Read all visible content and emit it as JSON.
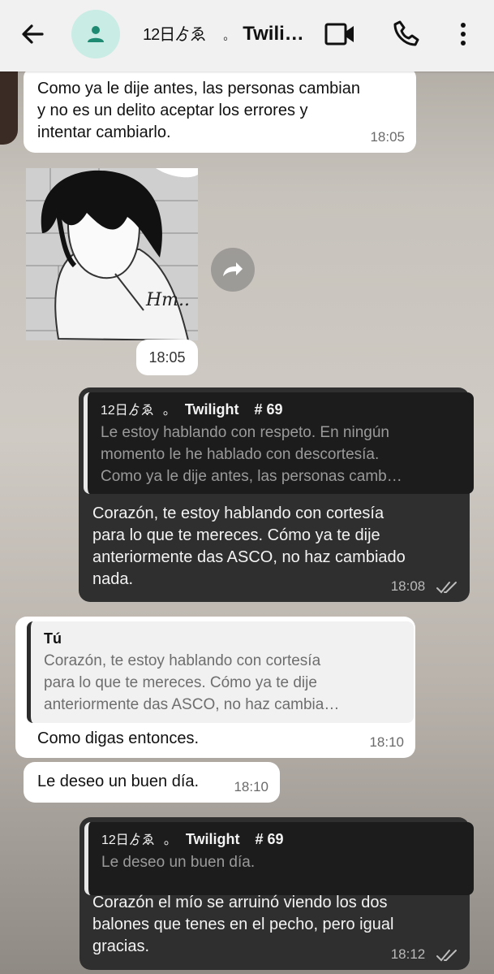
{
  "header": {
    "contact_glyph": "12日ゟゑ",
    "contact_dots": "。",
    "contact_name": "Twili…"
  },
  "messages": [
    {
      "direction": "in",
      "text": "Como ya le dije antes, las personas cambian\ny no es un delito aceptar los errores y\nintentar cambiarlo.",
      "time": "18:05"
    },
    {
      "direction": "in",
      "type": "image",
      "signature": "Hm..",
      "time": "18:05"
    },
    {
      "direction": "out",
      "quote_glyph": "12日ゟゑ",
      "quote_dots": "。",
      "quote_author": "Twilight",
      "quote_tag": "# 69",
      "quote_text": "Le estoy hablando con respeto. En ningún\nmomento le he hablado con descortesía.\nComo ya le dije antes, las personas camb…",
      "text": "Corazón, te estoy hablando con cortesía\npara lo que te mereces. Cómo ya te dije\nanteriormente das ASCO, no haz cambiado\nnada.",
      "time": "18:08"
    },
    {
      "direction": "in",
      "quote_author": "Tú",
      "quote_text": "Corazón, te estoy hablando con cortesía\npara lo que te mereces. Cómo ya te dije\nanteriormente das ASCO, no haz cambia…",
      "text": "Como digas entonces.",
      "time": "18:10"
    },
    {
      "direction": "in",
      "text": "Le deseo un buen día.",
      "time": "18:10"
    },
    {
      "direction": "out",
      "quote_glyph": "12日ゟゑ",
      "quote_dots": "。",
      "quote_author": "Twilight",
      "quote_tag": "# 69",
      "quote_text": "Le deseo un buen día.",
      "text": "Corazón el mío se arruinó viendo los dos\nbalones que tenes en el pecho, pero igual\ngracias.",
      "time": "18:12"
    }
  ],
  "icons": {
    "back": "arrow-left-icon",
    "avatar": "person-icon",
    "video": "video-camera-icon",
    "phone": "phone-icon",
    "menu": "more-vertical-icon",
    "forward": "forward-icon",
    "read": "double-check-icon"
  },
  "colors": {
    "header_bg": "#f1f1f1",
    "avatar_bg": "#c9ece4",
    "avatar_icon": "#1f8a72",
    "incoming_bubble": "#ffffff",
    "outgoing_bubble": "#2f2f2f"
  }
}
